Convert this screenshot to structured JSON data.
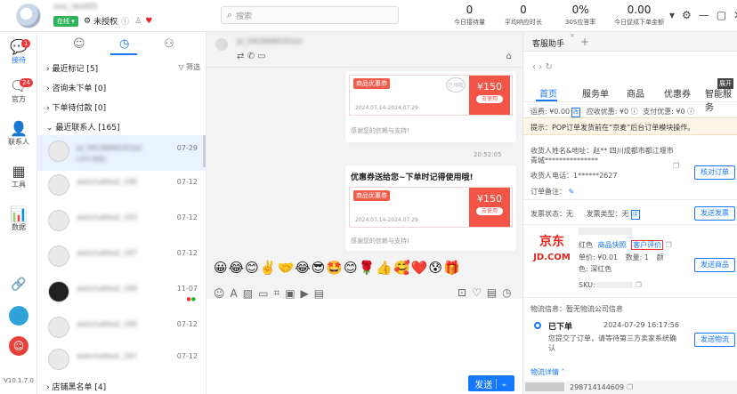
{
  "app": {
    "account_name": "xxx_test05",
    "status": "在线",
    "auth_text": "未授权",
    "version": "V10.1.7.0"
  },
  "search": {
    "placeholder": "搜索"
  },
  "stats": [
    {
      "value": "0",
      "label": "今日接待量"
    },
    {
      "value": "0",
      "label": "平均响应时长"
    },
    {
      "value": "0%",
      "label": "30S应答率"
    },
    {
      "value": "0.00",
      "label": "今日促成下单金额"
    }
  ],
  "rail": {
    "items": [
      {
        "label": "接待",
        "badge": "1",
        "icon": "chat-bubble-icon"
      },
      {
        "label": "官方",
        "badge": "24",
        "icon": "official-icon"
      },
      {
        "label": "联系人",
        "icon": "contact-icon"
      },
      {
        "label": "工具",
        "icon": "grid-icon"
      },
      {
        "label": "数据",
        "icon": "bar-chart-icon"
      }
    ]
  },
  "list": {
    "filter_label": "筛选",
    "groups": [
      {
        "label": "最近标记 [5]"
      },
      {
        "label": "咨询未下单 [0]"
      },
      {
        "label": "下单待付款 [0]"
      },
      {
        "label": "最近联系人 [165]"
      }
    ],
    "contacts": [
      {
        "name": "jd_5f6386893f1bd",
        "sub": "[卡片消息]",
        "time": "07-29"
      },
      {
        "name": "welichattest_196",
        "time": "07-12"
      },
      {
        "name": "welichattest_193",
        "time": "07-12"
      },
      {
        "name": "welichattest_187",
        "time": "07-12"
      },
      {
        "name": "welichattest_189",
        "time": "11-07"
      },
      {
        "name": "welichattest_184",
        "time": "07-12"
      },
      {
        "name": "welichattest_187",
        "time": "07-12"
      }
    ],
    "blacklist_label": "店铺黑名单 [4]"
  },
  "chat": {
    "header_name": "jd_5f6386893f1bd",
    "coupon": {
      "tag": "商品优惠券",
      "amount": "¥150",
      "button": "去使用",
      "date": "2024.07.14-2024.07.29",
      "received_stamp": "已领取"
    },
    "thanks_text": "感谢您的信赖与支持!",
    "timestamp": "20:52:05",
    "promo_title": "优惠券送给您~下单时记得使用哦!",
    "emojis": "😀😂😊✌️🤝😂😎🤩😊🌹👍🥰❤️😰🎁",
    "send_label": "发送"
  },
  "panel": {
    "title": "客服助手",
    "tabs": [
      "首页",
      "服务单",
      "商品",
      "优惠券",
      "智能服务"
    ],
    "overflow_label": "展开",
    "fees": {
      "freight": "运费: ¥0.00",
      "freight_tag": "改",
      "receivable": "应收优惠: ¥0",
      "paid": "支付优惠: ¥0"
    },
    "notice": "提示：POP订单发货前在“京麦”后台订单模块操作。",
    "receiver": {
      "name_label": "收货人姓名&地址：赵** 四川成都市都江堰市",
      "name_line2": "青城***************",
      "phone": "收货人电话：1******2627",
      "remark": "订单备注：",
      "check_btn": "核对订单"
    },
    "invoice": {
      "state": "发票状态：无",
      "type": "发票类型：无",
      "type_tag": "详",
      "btn": "发送发票"
    },
    "product": {
      "color_label": "红色",
      "link1": "商品快照",
      "link2": "客户评价",
      "price": "单价: ¥0.01",
      "qty": "数量: 1",
      "qty_extra": "颜",
      "color": "色: 深红色",
      "sku": "SKU:",
      "btn": "发送商品",
      "logo_cn": "京东",
      "logo_en": "JD.COM"
    },
    "logistics": {
      "header": "物流信息：暂无物流公司信息",
      "status": "已下单",
      "time": "2024-07-29 16:17:56",
      "desc": "您提交了订单，请等待第三方卖家系统确认",
      "btn": "发送物流",
      "detail_link": "物流详情",
      "order_no": "298714144609"
    }
  }
}
